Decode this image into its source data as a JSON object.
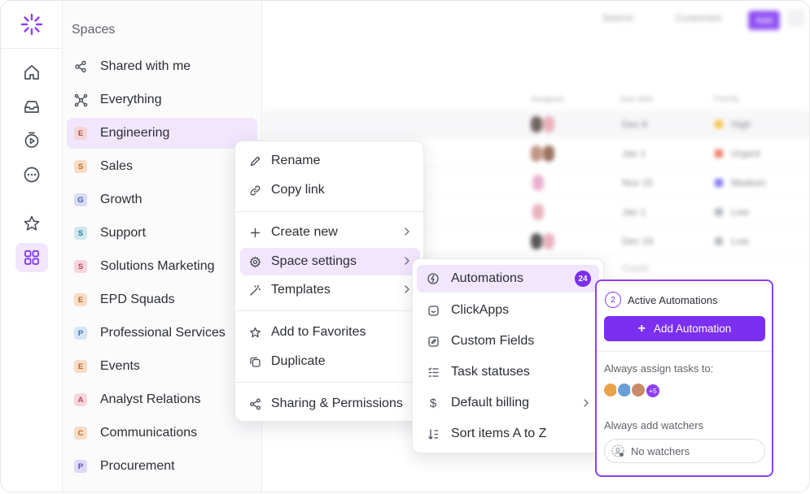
{
  "rail": {
    "items": [
      "home",
      "inbox",
      "timer",
      "more",
      "favorites",
      "spaces"
    ]
  },
  "spaces": {
    "title": "Spaces",
    "items": [
      {
        "label": "Shared with me",
        "icon": "share-icon"
      },
      {
        "label": "Everything",
        "icon": "everything-icon"
      },
      {
        "label": "Engineering",
        "letter": "E",
        "color": "#f2d6d6",
        "text_color": "#b94a4a",
        "active": true
      },
      {
        "label": "Sales",
        "letter": "S",
        "color": "#f8dcc5",
        "text_color": "#b36a2c"
      },
      {
        "label": "Growth",
        "letter": "G",
        "color": "#d8dcf6",
        "text_color": "#4a56b3"
      },
      {
        "label": "Support",
        "letter": "S",
        "color": "#cfe6ee",
        "text_color": "#2f7b95"
      },
      {
        "label": "Solutions Marketing",
        "letter": "S",
        "color": "#f6d6dc",
        "text_color": "#b4475e"
      },
      {
        "label": "EPD Squads",
        "letter": "E",
        "color": "#f8dcc5",
        "text_color": "#b36a2c"
      },
      {
        "label": "Professional Services",
        "letter": "P",
        "color": "#d6e6f6",
        "text_color": "#3f73ab"
      },
      {
        "label": "Events",
        "letter": "E",
        "color": "#f8dcc5",
        "text_color": "#b36a2c"
      },
      {
        "label": "Analyst Relations",
        "letter": "A",
        "color": "#f6d6dc",
        "text_color": "#b4475e"
      },
      {
        "label": "Communications",
        "letter": "C",
        "color": "#f8dcc5",
        "text_color": "#b36a2c"
      },
      {
        "label": "Procurement",
        "letter": "P",
        "color": "#dcd8f6",
        "text_color": "#5a48b3"
      }
    ]
  },
  "background": {
    "search_label": "Search",
    "customize_label": "Customize",
    "action_label": "Add",
    "columns": [
      "Assignee",
      "Due date",
      "Priority"
    ],
    "rows": [
      {
        "due": "Dec 6",
        "priority": "High",
        "flag": "#f5b82e"
      },
      {
        "due": "Jan 1",
        "priority": "Urgent",
        "flag": "#e8664a"
      },
      {
        "due": "Nov 15",
        "priority": "Medium",
        "flag": "#6a5ef0"
      },
      {
        "due": "Jan 1",
        "priority": "Low",
        "flag": "#aab0b8"
      },
      {
        "due": "Dec 19",
        "priority": "Low",
        "flag": "#aab0b8"
      }
    ],
    "count_label": "Count"
  },
  "menu": {
    "items": [
      {
        "label": "Rename",
        "icon": "pencil-icon"
      },
      {
        "label": "Copy link",
        "icon": "link-icon"
      },
      {
        "label": "Create new",
        "icon": "plus-icon",
        "has_submenu": true
      },
      {
        "label": "Space settings",
        "icon": "gear-icon",
        "has_submenu": true,
        "active": true
      },
      {
        "label": "Templates",
        "icon": "magic-wand-icon",
        "has_submenu": true
      },
      {
        "label": "Add to Favorites",
        "icon": "star-icon"
      },
      {
        "label": "Duplicate",
        "icon": "duplicate-icon"
      },
      {
        "label": "Sharing & Permissions",
        "icon": "share-icon"
      }
    ]
  },
  "submenu": {
    "items": [
      {
        "label": "Automations",
        "icon": "automation-icon",
        "count": "24",
        "active": true
      },
      {
        "label": "ClickApps",
        "icon": "clickapps-icon"
      },
      {
        "label": "Custom Fields",
        "icon": "custom-fields-icon"
      },
      {
        "label": "Task statuses",
        "icon": "statuses-icon"
      },
      {
        "label": "Default billing",
        "icon": "dollar-icon",
        "has_submenu": true
      },
      {
        "label": "Sort items A to Z",
        "icon": "sort-icon"
      }
    ]
  },
  "automations": {
    "count": "2",
    "title": "Active Automations",
    "add_label": "Add Automation",
    "assign_label": "Always assign tasks to:",
    "more_count": "+5",
    "watchers_label": "Always add watchers",
    "no_watchers": "No watchers"
  },
  "colors": {
    "accent": "#7b2ff0",
    "accent_light": "#f1e6fd",
    "panel_border": "#8d3ff5"
  }
}
